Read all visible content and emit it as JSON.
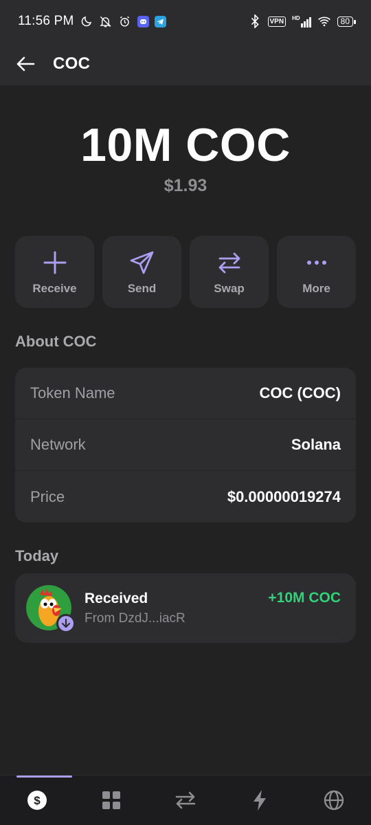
{
  "status_bar": {
    "time": "11:56 PM",
    "vpn_label": "VPN",
    "network_label": "HD",
    "battery": "80"
  },
  "header": {
    "title": "COC"
  },
  "balance": {
    "amount": "10M COC",
    "usd": "$1.93"
  },
  "actions": [
    {
      "label": "Receive",
      "icon": "plus-icon"
    },
    {
      "label": "Send",
      "icon": "send-icon"
    },
    {
      "label": "Swap",
      "icon": "swap-icon"
    },
    {
      "label": "More",
      "icon": "more-icon"
    }
  ],
  "about": {
    "title": "About COC",
    "rows": [
      {
        "key": "Token Name",
        "value": "COC (COC)"
      },
      {
        "key": "Network",
        "value": "Solana"
      },
      {
        "key": "Price",
        "value": "$0.00000019274"
      }
    ]
  },
  "activity": {
    "section_title": "Today",
    "items": [
      {
        "title": "Received",
        "subtitle": "From DzdJ...iacR",
        "amount": "+10M COC"
      }
    ]
  },
  "bottom_nav": {
    "active_index": 0,
    "items": [
      "dollar-icon",
      "grid-icon",
      "swap-arrows-icon",
      "lightning-icon",
      "globe-icon"
    ]
  },
  "colors": {
    "accent": "#ab9ff2",
    "positive": "#33d17a",
    "background": "#222222",
    "card": "#2d2d30"
  }
}
